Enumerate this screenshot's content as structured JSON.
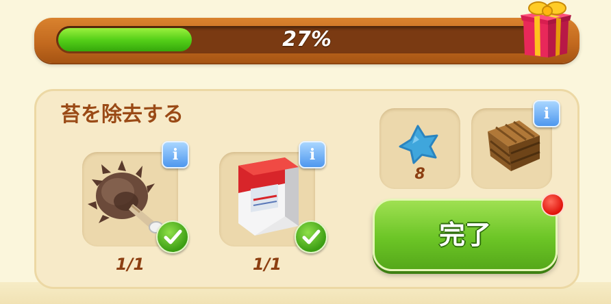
{
  "progress": {
    "value": 0.27,
    "label": "27%"
  },
  "task": {
    "title": "苔を除去する"
  },
  "items": [
    {
      "icon": "feather-duster-icon",
      "count": "1/1",
      "done": true
    },
    {
      "icon": "cleaner-box-icon",
      "count": "1/1",
      "done": true
    }
  ],
  "rewards": [
    {
      "icon": "blue-star-icon",
      "count": "8"
    },
    {
      "icon": "wooden-crate-icon"
    }
  ],
  "complete_button": {
    "label": "完了"
  },
  "colors": {
    "accent_green": "#6cc526",
    "progress_bar": "#c36a1f",
    "title_text": "#9a4a16"
  }
}
